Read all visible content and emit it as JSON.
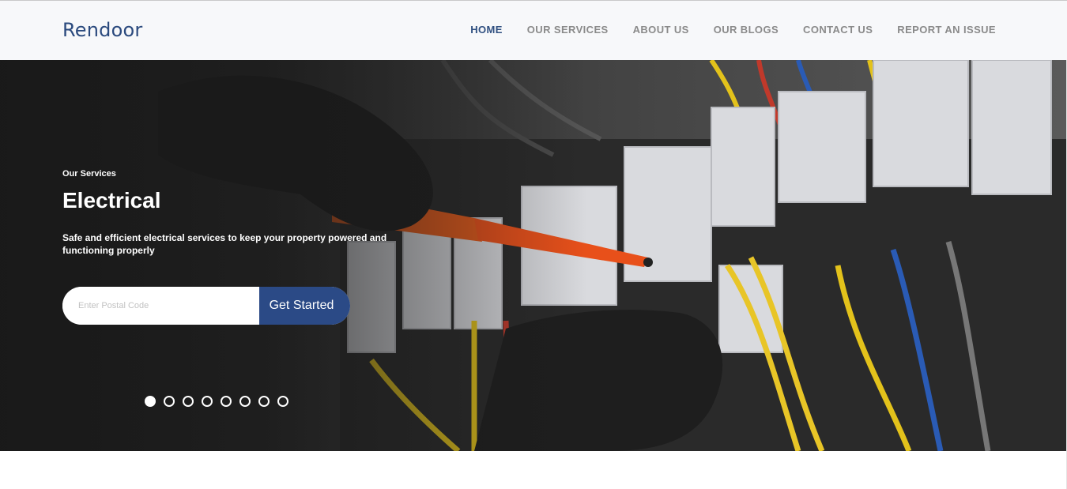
{
  "brand": {
    "name": "Rendoor",
    "accent": "#2b4a86"
  },
  "nav": {
    "items": [
      {
        "label": "HOME",
        "active": true
      },
      {
        "label": "OUR SERVICES",
        "active": false
      },
      {
        "label": "ABOUT US",
        "active": false
      },
      {
        "label": "OUR BLOGS",
        "active": false
      },
      {
        "label": "CONTACT US",
        "active": false
      },
      {
        "label": "REPORT AN ISSUE",
        "active": false
      }
    ]
  },
  "hero": {
    "eyebrow": "Our Services",
    "title": "Electrical",
    "description": "Safe and efficient electrical services to keep your property powered and functioning properly",
    "search": {
      "value": "",
      "placeholder": "Enter Postal Code",
      "button_label": "Get Started"
    },
    "carousel": {
      "slide_count": 8,
      "active_index": 0
    }
  }
}
